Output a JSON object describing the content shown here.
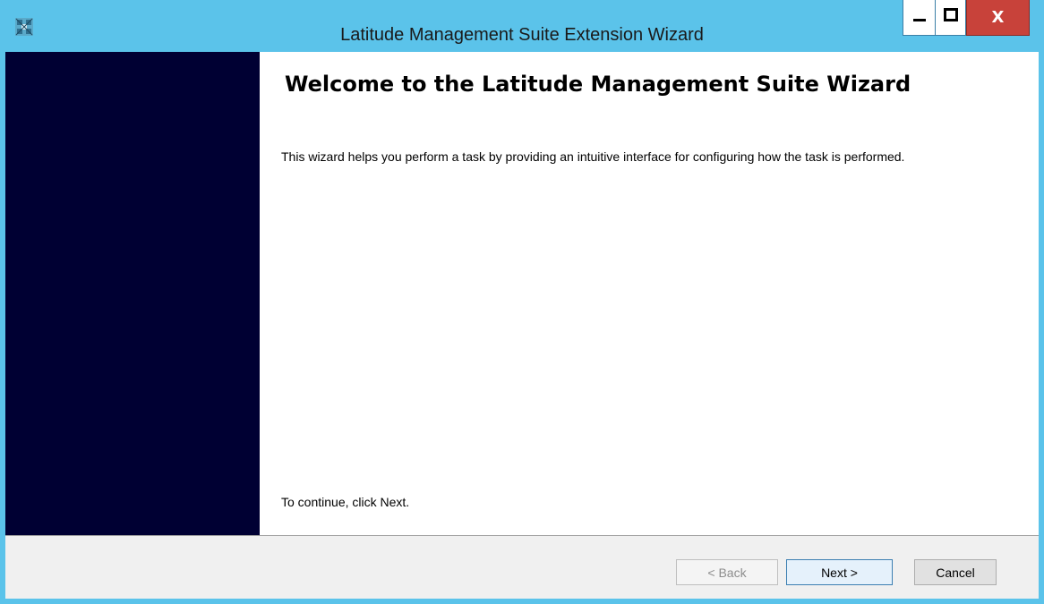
{
  "window": {
    "title": "Latitude Management Suite Extension Wizard",
    "icon": "wizard-app-icon",
    "controls": {
      "minimize": "minimize-icon",
      "maximize": "maximize-icon",
      "close": "close-icon",
      "close_label": "X"
    }
  },
  "content": {
    "heading": "Welcome to the Latitude Management Suite Wizard",
    "description": "This wizard helps you perform a task by providing an intuitive interface for configuring how the task is performed.",
    "continue_text": "To continue, click Next."
  },
  "buttons": {
    "back_label": "< Back",
    "next_label": "Next >",
    "cancel_label": "Cancel"
  },
  "colors": {
    "titlebar": "#5bc3ea",
    "side_panel": "#000033",
    "close_button": "#c8423a"
  }
}
